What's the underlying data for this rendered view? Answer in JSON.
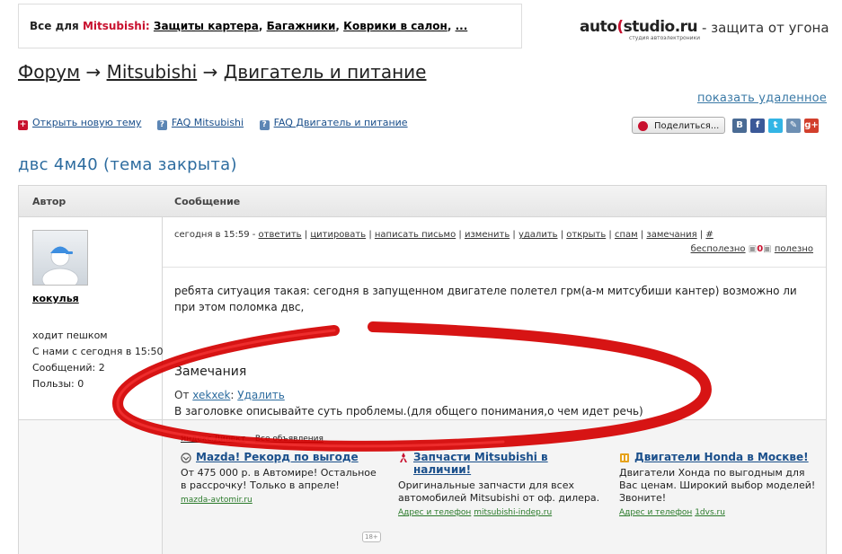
{
  "top_banner": {
    "prefix": "Все для ",
    "brand": "Mitsubishi:",
    "links": [
      "Защиты картера",
      "Багажники",
      "Коврики в салон",
      "..."
    ]
  },
  "logo": {
    "part1": "auto",
    "part2": "studio.ru",
    "sub": "студия автоэлектроники"
  },
  "tagline": "- защита от угона",
  "breadcrumb": {
    "items": [
      "Форум",
      "Mitsubishi",
      "Двигатель и питание"
    ],
    "separator": "→"
  },
  "show_deleted": "показать удаленное",
  "toolbar": {
    "new_topic": "Открыть новую тему",
    "faq_brand": "FAQ Mitsubishi",
    "faq_section": "FAQ Двигатель и питание",
    "share_label": "Поделиться..."
  },
  "topic_title": "двс 4м40 (тема закрыта)",
  "table_headers": {
    "author": "Автор",
    "message": "Сообщение"
  },
  "post": {
    "author": "кокулья",
    "status": "ходит пешком",
    "since": "С нами с сегодня в 15:50",
    "posts": "Сообщений: 2",
    "useful": "Пользы: 0",
    "time": "сегодня в 15:59",
    "actions": [
      "ответить",
      "цитировать",
      "написать письмо",
      "изменить",
      "удалить",
      "открыть",
      "спам",
      "замечания",
      "#"
    ],
    "useless_label": "бесполезно",
    "vote_count": "0",
    "useful_label": "полезно",
    "text": "ребята ситуация такая: сегодня в запущенном двигателе полетел грм(а-м   митсубиши кантер) возможно ли при этом поломка двс,"
  },
  "notes": {
    "heading": "Замечания",
    "from_label": "От",
    "from_user": "xekxek",
    "delete_label": "Удалить",
    "text": "В заголовке описывайте суть проблемы.(для общего понимания,о чем идет речь)"
  },
  "ads": {
    "header_items": [
      "Яндекс.Директ",
      "Все объявления"
    ],
    "items": [
      {
        "title": "Mazda! Рекорд по выгоде",
        "body": "От 475 000 р. в Автомире! Остальное в рассрочку! Только в апреле!",
        "domain": "mazda-avtomir.ru",
        "contact": ""
      },
      {
        "title": "Запчасти Mitsubishi в наличии!",
        "body": "Оригинальные запчасти для всех автомобилей Mitsubishi от оф. дилера.",
        "domain": "mitsubishi-indep.ru",
        "contact": "Адрес и телефон"
      },
      {
        "title": "Двигатели Honda в Москве!",
        "body": "Двигатели Хонда по выгодным для Вас ценам. Широкий выбор моделей! Звоните!",
        "domain": "1dvs.ru",
        "contact": "Адрес и телефон"
      }
    ],
    "age_label": "18+"
  },
  "colors": {
    "accent": "#2d6c9f",
    "brand_red": "#c8102e",
    "annotation_red": "#d40000"
  }
}
